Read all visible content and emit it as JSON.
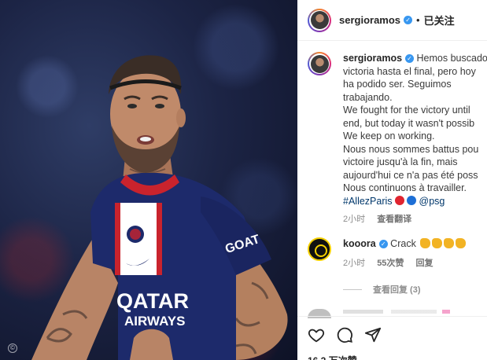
{
  "photo": {
    "jersey_sponsor_line1": "QATAR",
    "jersey_sponsor_line2": "AIRWAYS",
    "sleeve_text": "GOAT",
    "watermark": "©"
  },
  "post": {
    "header": {
      "username": "sergioramos",
      "separator": "•",
      "follow_label": "已关注"
    },
    "caption": {
      "username": "sergioramos",
      "lines": [
        "Hemos buscado",
        "victoria hasta el final, pero hoy",
        "ha podido ser. Seguimos",
        "trabajando.",
        "We fought for the victory until",
        "end, but today it wasn't possib",
        "We keep on working.",
        "Nous nous sommes battus pou",
        "victoire jusqu'à la fin, mais",
        "aujourd'hui ce n'a pas été poss",
        "Nous continuons à travailler."
      ],
      "hashtag": "#AllezParis",
      "mention": "@psg",
      "time": "2小时",
      "translate_label": "查看翻译"
    },
    "comment": {
      "username": "kooora",
      "text": "Crack",
      "time": "2小时",
      "likes": "55次赞",
      "reply_label": "回复"
    },
    "view_replies_label": "查看回复 (3)",
    "actions": {
      "like_icon": "heart-icon",
      "comment_icon": "comment-icon",
      "share_icon": "share-icon"
    },
    "likes_count": "16.2 万次赞"
  }
}
